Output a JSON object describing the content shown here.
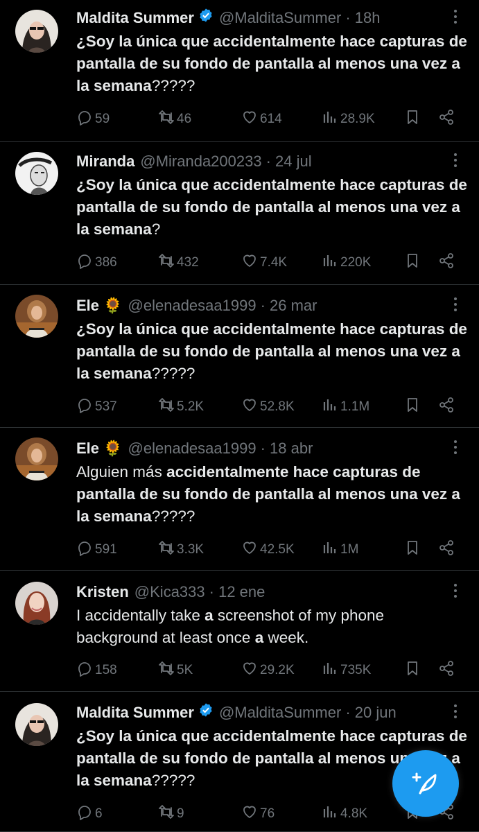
{
  "tweets": [
    {
      "name": "Maldita Summer",
      "verified": true,
      "handle": "@MalditaSummer",
      "time": "· 18h",
      "text": [
        {
          "t": "¿Soy la única que accidentalmente hace capturas de pantalla de su fondo de pantalla al menos una vez a la semana",
          "b": true
        },
        {
          "t": "?????",
          "b": false
        }
      ],
      "replies": "59",
      "retweets": "46",
      "likes": "614",
      "views": "28.9K"
    },
    {
      "name": "Miranda",
      "verified": false,
      "handle": "@Miranda200233",
      "time": "· 24 jul",
      "text": [
        {
          "t": "¿Soy la única que accidentalmente hace capturas de pantalla de su fondo de pantalla al menos una vez a la semana",
          "b": true
        },
        {
          "t": "?",
          "b": false
        }
      ],
      "replies": "386",
      "retweets": "432",
      "likes": "7.4K",
      "views": "220K"
    },
    {
      "name": "Ele 🌻",
      "verified": false,
      "handle": "@elenadesaa1999",
      "time": "· 26 mar",
      "text": [
        {
          "t": "¿Soy la única que accidentalmente hace capturas de pantalla de su fondo de pantalla al menos una vez a la semana",
          "b": true
        },
        {
          "t": "?????",
          "b": false
        }
      ],
      "replies": "537",
      "retweets": "5.2K",
      "likes": "52.8K",
      "views": "1.1M"
    },
    {
      "name": "Ele 🌻",
      "verified": false,
      "handle": "@elenadesaa1999",
      "time": "· 18 abr",
      "text": [
        {
          "t": "Alguien más ",
          "b": false
        },
        {
          "t": "accidentalmente hace capturas de pantalla de su fondo de pantalla al menos una vez a la semana",
          "b": true
        },
        {
          "t": "?????",
          "b": false
        }
      ],
      "replies": "591",
      "retweets": "3.3K",
      "likes": "42.5K",
      "views": "1M"
    },
    {
      "name": "Kristen",
      "verified": false,
      "handle": "@Kica333",
      "time": "· 12 ene",
      "text": [
        {
          "t": "I accidentally take ",
          "b": false
        },
        {
          "t": "a",
          "b": true
        },
        {
          "t": " screenshot of my phone background at least once ",
          "b": false
        },
        {
          "t": "a",
          "b": true
        },
        {
          "t": " week.",
          "b": false
        }
      ],
      "replies": "158",
      "retweets": "5K",
      "likes": "29.2K",
      "views": "735K"
    },
    {
      "name": "Maldita Summer",
      "verified": true,
      "handle": "@MalditaSummer",
      "time": "· 20 jun",
      "text": [
        {
          "t": "¿Soy la única que accidentalmente hace capturas de pantalla de su fondo de pantalla al menos una vez a la semana",
          "b": true
        },
        {
          "t": "?????",
          "b": false
        }
      ],
      "replies": "6",
      "retweets": "9",
      "likes": "76",
      "views": "4.8K"
    }
  ],
  "colors": {
    "background": "#000000",
    "text": "#e7e9ea",
    "muted": "#71767b",
    "accent": "#1d9bf0",
    "divider": "#2f3336"
  },
  "icons": {
    "reply": "reply-icon",
    "retweet": "retweet-icon",
    "like": "heart-icon",
    "views": "views-icon",
    "bookmark": "bookmark-icon",
    "share": "share-icon",
    "more": "more-dots-icon",
    "verified": "verified-badge-icon",
    "compose": "compose-icon"
  }
}
